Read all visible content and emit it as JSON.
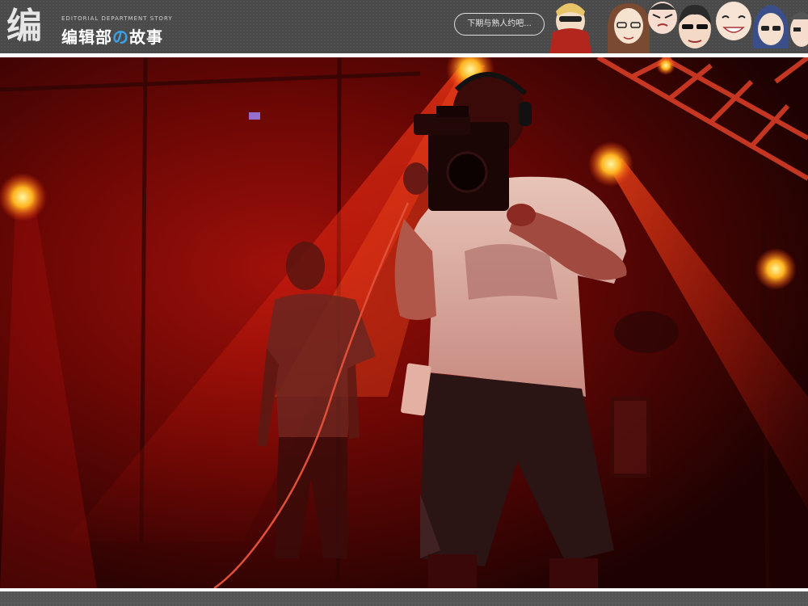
{
  "header": {
    "logo_glyph": "编",
    "logo_subtitle": "EDITORIAL DEPARTMENT STORY",
    "logo_title_part1": "编辑部",
    "logo_title_no": "の",
    "logo_title_part2": "故事",
    "speech_bubble": "下期与熟人约吧...",
    "colors": {
      "banner_bg": "#4a4a4a",
      "accent_blue": "#3aa3e8"
    }
  },
  "photo": {
    "subject": "stage-camera-operator",
    "colors": {
      "stage_light": "#ff2a10",
      "spot_center": "#ffcc33"
    }
  }
}
